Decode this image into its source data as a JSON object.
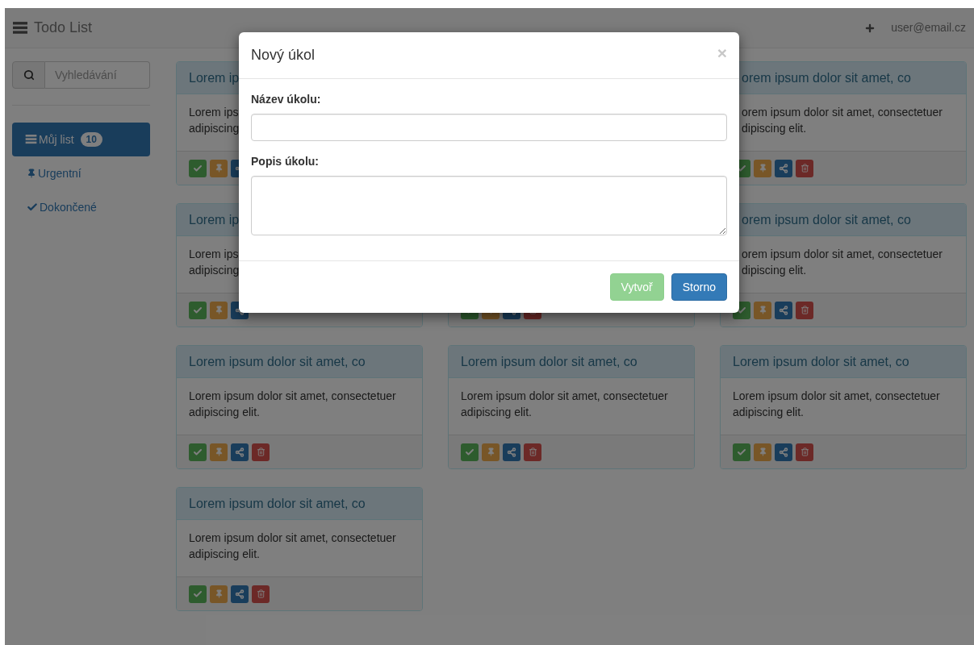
{
  "navbar": {
    "brand": "Todo List",
    "user": "user@email.cz"
  },
  "sidebar": {
    "search": {
      "placeholder": "Vyhledávání"
    },
    "items": [
      {
        "kind": "list",
        "label": "Můj list",
        "badge": "10",
        "selected": true
      },
      {
        "kind": "pin",
        "label": "Urgentní",
        "selected": false
      },
      {
        "kind": "check",
        "label": "Dokončené",
        "selected": false
      }
    ]
  },
  "cards": [
    {
      "kind": "cut_right",
      "title": "Lorem ip",
      "body_lines": [
        "Lorem ips",
        "adipiscing"
      ]
    },
    {
      "kind": "hidden"
    },
    {
      "kind": "cut_left",
      "title": "orem ipsum dolor sit amet, co",
      "body_lines": [
        "orem ipsum dolor sit amet, consectetuer",
        "dipiscing elit."
      ]
    },
    {
      "kind": "cut_right",
      "title": "Lorem ip",
      "body_lines": [
        "Lorem ips",
        "adipiscing"
      ]
    },
    {
      "kind": "footer_only"
    },
    {
      "kind": "cut_left",
      "title": "orem ipsum dolor sit amet, co",
      "body_lines": [
        "orem ipsum dolor sit amet, consectetuer",
        "dipiscing elit."
      ]
    },
    {
      "kind": "full",
      "title": "Lorem ipsum dolor sit amet, co",
      "body_lines": [
        "Lorem ipsum dolor sit amet, consectetuer",
        "adipiscing elit."
      ]
    },
    {
      "kind": "full",
      "title": "Lorem ipsum dolor sit amet, co",
      "body_lines": [
        "Lorem ipsum dolor sit amet, consectetuer",
        "adipiscing elit."
      ]
    },
    {
      "kind": "full",
      "title": "Lorem ipsum dolor sit amet, co",
      "body_lines": [
        "Lorem ipsum dolor sit amet, consectetuer",
        "adipiscing elit."
      ]
    },
    {
      "kind": "full",
      "title": "Lorem ipsum dolor sit amet, co",
      "body_lines": [
        "Lorem ipsum dolor sit amet, consectetuer",
        "adipiscing elit."
      ]
    }
  ],
  "modal": {
    "title": "Nový úkol",
    "close": "×",
    "fields": [
      {
        "kind": "input",
        "label": "Název úkolu:"
      },
      {
        "kind": "textarea",
        "label": "Popis úkolu:"
      }
    ],
    "buttons": [
      {
        "kind": "success",
        "label": "Vytvoř",
        "disabled": true
      },
      {
        "kind": "primary",
        "label": "Storno",
        "disabled": false
      }
    ]
  }
}
